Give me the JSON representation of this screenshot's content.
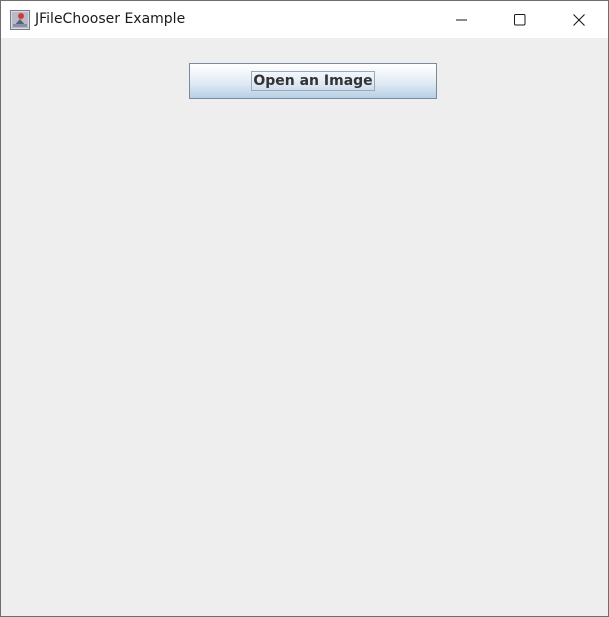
{
  "window": {
    "title": "JFileChooser Example",
    "controls": {
      "minimize_icon": "minimize-icon",
      "maximize_icon": "maximize-icon",
      "close_icon": "close-icon"
    }
  },
  "main": {
    "open_button_label": "Open an Image"
  },
  "colors": {
    "background": "#eeeeee",
    "titlebar": "#ffffff",
    "button_gradient_top": "#ffffff",
    "button_gradient_bottom": "#b8cfe5",
    "button_border": "#7a8a9c",
    "button_text": "#333333"
  }
}
